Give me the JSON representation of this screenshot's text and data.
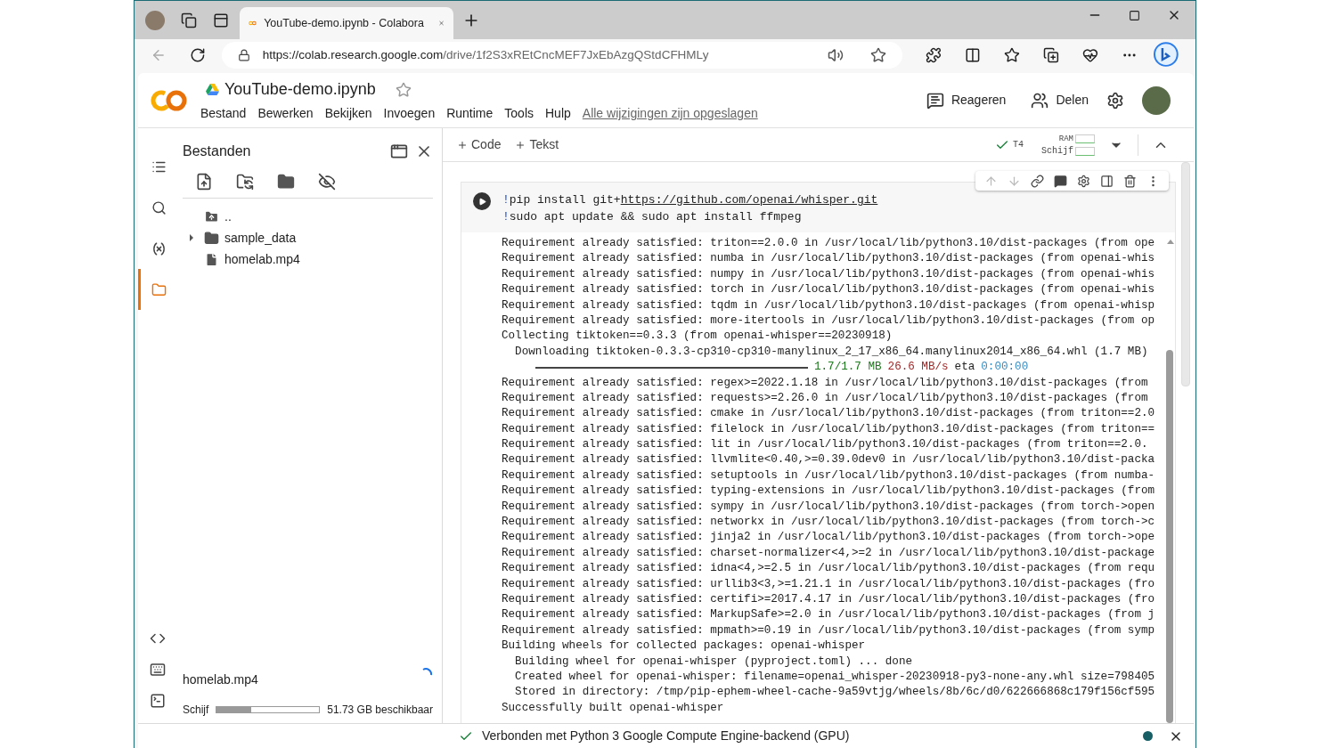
{
  "browser": {
    "tab_title": "YouTube-demo.ipynb - Colabora",
    "url_host": "https://colab.research.google.com",
    "url_path": "/drive/1f2S3xREtCncMEF7JxEbAzgQStdCFHMLy"
  },
  "header": {
    "title": "YouTube-demo.ipynb",
    "starred": false,
    "menu": [
      "Bestand",
      "Bewerken",
      "Bekijken",
      "Invoegen",
      "Runtime",
      "Tools",
      "Hulp"
    ],
    "save_status": "Alle wijzigingen zijn opgeslagen",
    "comment_label": "Reageren",
    "share_label": "Delen"
  },
  "rail": {
    "top": [
      {
        "kind": "toc",
        "selected": false
      },
      {
        "kind": "search",
        "selected": false
      },
      {
        "kind": "variables",
        "selected": false
      },
      {
        "kind": "files",
        "selected": true
      }
    ],
    "bottom": [
      {
        "kind": "snippets"
      },
      {
        "kind": "palette"
      },
      {
        "kind": "terminal"
      }
    ]
  },
  "files_panel": {
    "title": "Bestanden",
    "tree": [
      {
        "kind": "parent",
        "name": ".."
      },
      {
        "kind": "folder",
        "name": "sample_data",
        "expanded": false
      },
      {
        "kind": "file",
        "name": "homelab.mp4"
      }
    ],
    "upload": {
      "name": "homelab.mp4"
    },
    "disk": {
      "label": "Schijf",
      "level": 0.34,
      "free": "51.73 GB beschikbaar"
    }
  },
  "toolbar": {
    "add_code": "Code",
    "add_text": "Tekst",
    "runtime": "T4",
    "connected": true,
    "ram_label": "RAM",
    "disk_label": "Schijf"
  },
  "cell": {
    "code_lines": [
      {
        "magic": "!",
        "command": "pip install git+",
        "link": "https://github.com/openai/whisper.git"
      },
      {
        "magic": "!",
        "command": "sudo apt update && sudo apt install ffmpeg"
      }
    ],
    "output": [
      {
        "kind": "text",
        "text": "Requirement already satisfied: triton==2.0.0 in /usr/local/lib/python3.10/dist-packages (from ope"
      },
      {
        "kind": "text",
        "text": "Requirement already satisfied: numba in /usr/local/lib/python3.10/dist-packages (from openai-whis"
      },
      {
        "kind": "text",
        "text": "Requirement already satisfied: numpy in /usr/local/lib/python3.10/dist-packages (from openai-whis"
      },
      {
        "kind": "text",
        "text": "Requirement already satisfied: torch in /usr/local/lib/python3.10/dist-packages (from openai-whis"
      },
      {
        "kind": "text",
        "text": "Requirement already satisfied: tqdm in /usr/local/lib/python3.10/dist-packages (from openai-whisp"
      },
      {
        "kind": "text",
        "text": "Requirement already satisfied: more-itertools in /usr/local/lib/python3.10/dist-packages (from op"
      },
      {
        "kind": "text",
        "text": "Collecting tiktoken==0.3.3 (from openai-whisper==20230918)"
      },
      {
        "kind": "text",
        "text": "  Downloading tiktoken-0.3.3-cp310-cp310-manylinux_2_17_x86_64.manylinux2014_x86_64.whl (1.7 MB)"
      },
      {
        "kind": "progress",
        "level": 1,
        "size": "1.7/1.7 MB",
        "speed": "26.6 MB/s",
        "eta_label": "eta",
        "eta": "0:00:00"
      },
      {
        "kind": "text",
        "text": "Requirement already satisfied: regex>=2022.1.18 in /usr/local/lib/python3.10/dist-packages (from"
      },
      {
        "kind": "text",
        "text": "Requirement already satisfied: requests>=2.26.0 in /usr/local/lib/python3.10/dist-packages (from"
      },
      {
        "kind": "text",
        "text": "Requirement already satisfied: cmake in /usr/local/lib/python3.10/dist-packages (from triton==2.0"
      },
      {
        "kind": "text",
        "text": "Requirement already satisfied: filelock in /usr/local/lib/python3.10/dist-packages (from triton=="
      },
      {
        "kind": "text",
        "text": "Requirement already satisfied: lit in /usr/local/lib/python3.10/dist-packages (from triton==2.0."
      },
      {
        "kind": "text",
        "text": "Requirement already satisfied: llvmlite<0.40,>=0.39.0dev0 in /usr/local/lib/python3.10/dist-packa"
      },
      {
        "kind": "text",
        "text": "Requirement already satisfied: setuptools in /usr/local/lib/python3.10/dist-packages (from numba-"
      },
      {
        "kind": "text",
        "text": "Requirement already satisfied: typing-extensions in /usr/local/lib/python3.10/dist-packages (from"
      },
      {
        "kind": "text",
        "text": "Requirement already satisfied: sympy in /usr/local/lib/python3.10/dist-packages (from torch->open"
      },
      {
        "kind": "text",
        "text": "Requirement already satisfied: networkx in /usr/local/lib/python3.10/dist-packages (from torch->c"
      },
      {
        "kind": "text",
        "text": "Requirement already satisfied: jinja2 in /usr/local/lib/python3.10/dist-packages (from torch->ope"
      },
      {
        "kind": "text",
        "text": "Requirement already satisfied: charset-normalizer<4,>=2 in /usr/local/lib/python3.10/dist-package"
      },
      {
        "kind": "text",
        "text": "Requirement already satisfied: idna<4,>=2.5 in /usr/local/lib/python3.10/dist-packages (from requ"
      },
      {
        "kind": "text",
        "text": "Requirement already satisfied: urllib3<3,>=1.21.1 in /usr/local/lib/python3.10/dist-packages (fro"
      },
      {
        "kind": "text",
        "text": "Requirement already satisfied: certifi>=2017.4.17 in /usr/local/lib/python3.10/dist-packages (fro"
      },
      {
        "kind": "text",
        "text": "Requirement already satisfied: MarkupSafe>=2.0 in /usr/local/lib/python3.10/dist-packages (from j"
      },
      {
        "kind": "text",
        "text": "Requirement already satisfied: mpmath>=0.19 in /usr/local/lib/python3.10/dist-packages (from symp"
      },
      {
        "kind": "text",
        "text": "Building wheels for collected packages: openai-whisper"
      },
      {
        "kind": "text",
        "text": "  Building wheel for openai-whisper (pyproject.toml) ... done"
      },
      {
        "kind": "text",
        "text": "  Created wheel for openai-whisper: filename=openai_whisper-20230918-py3-none-any.whl size=798405"
      },
      {
        "kind": "text",
        "text": "  Stored in directory: /tmp/pip-ephem-wheel-cache-9a59vtjg/wheels/8b/6c/d0/622666868c179f156cf595"
      },
      {
        "kind": "text",
        "text": "Successfully built openai-whisper"
      }
    ]
  },
  "status_bar": {
    "connected": true,
    "text": "Verbonden met Python 3 Google Compute Engine-backend (GPU)",
    "color": "#185f65"
  }
}
